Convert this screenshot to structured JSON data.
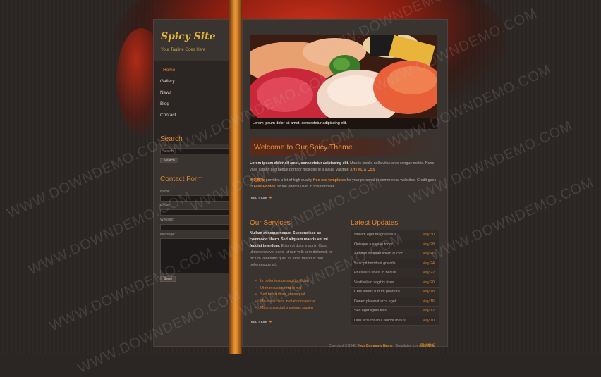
{
  "site": {
    "logo": "Spicy Site",
    "tagline": "Your Tagline Goes Here"
  },
  "nav": {
    "items": [
      {
        "label": "Home",
        "active": true
      },
      {
        "label": "Gallery"
      },
      {
        "label": "News"
      },
      {
        "label": "Blog"
      },
      {
        "label": "Contact"
      }
    ]
  },
  "search": {
    "heading": "Search",
    "placeholder": "Search",
    "button": "Search"
  },
  "contact": {
    "heading": "Contact Form",
    "name_label": "Name:",
    "email_label": "Email:",
    "website_label": "Website:",
    "message_label": "Message:",
    "send_label": "Send"
  },
  "hero": {
    "caption": "Lorem ipsum dolor sit amet, consectetur adipiscing elit."
  },
  "welcome": {
    "title": "Welcome to Our Spicy Theme",
    "p1_bold": "Lorem ipsum dolor sit amet, consectetur adipiscing elit.",
    "p1_text": " Mauris iaculis nulla vitae ante congue mattis. Nunc vitae sapien sed neque porttitor molestie id a lacus. Validate ",
    "p1_xhtml": "XHTML",
    "p1_and": " & ",
    "p1_css": "CSS",
    "p2_brand": "网站模板",
    "p2_text1": " provides a lot of high quality ",
    "p2_link": "free css templates",
    "p2_text2": " for your personal or commercial websites. Credit goes to ",
    "p2_photos": "Free Photos",
    "p2_text3": " for the photos used in this template.",
    "read_more": "read more"
  },
  "services": {
    "heading": "Our Services",
    "intro_bold": "Nullam at neque neque. Suspendisse ac commodo libero. Sed aliquam mauris vel mi feugiat interdum.",
    "intro_text": " Etiam ut dolor mauris. Cras ultrices nec vel nunc, ut non velit sem dictumst, in dictum venenatis quis, sit amet faucibus non pellentesque sit.",
    "bullets": [
      "In pellentesque sagittis dictum",
      "Ut rhoncus imperdiet nisi",
      "Sed tellus diam, consequat",
      "Mauris in risus in diam consequat",
      "Mauris suscipit maximus sapien"
    ],
    "read_more": "read more"
  },
  "updates": {
    "heading": "Latest Updates",
    "rows": [
      {
        "title": "Nullam eget magna tellus",
        "date": "May 30"
      },
      {
        "title": "Quisque a sapien tortor",
        "date": "May 28"
      },
      {
        "title": "Aenean sit amet libero auctor",
        "date": "May 26"
      },
      {
        "title": "Suscipit tincidunt gravida",
        "date": "May 24"
      },
      {
        "title": "Phasellus ut est in neque",
        "date": "May 22"
      },
      {
        "title": "Vestibulum sagittis risus",
        "date": "May 20"
      },
      {
        "title": "Cras varius rutrum pharetra",
        "date": "May 18"
      },
      {
        "title": "Donec placerat arcu eget",
        "date": "May 16"
      },
      {
        "title": "Sed eget ligula felis",
        "date": "May 12"
      },
      {
        "title": "Duis accumsan a auctor metus",
        "date": "May 10"
      }
    ]
  },
  "footer": {
    "prefix": "Copyright © 2048 ",
    "company": "Your Company Name",
    "mid": " | Templates from ",
    "brand": "网站模板"
  },
  "watermark": "WWW.DOWNDEMO.COM",
  "colors": {
    "accent": "#e8862e",
    "logo": "#e8b43a",
    "panel": "#3a3431",
    "background": "#2b2623"
  }
}
